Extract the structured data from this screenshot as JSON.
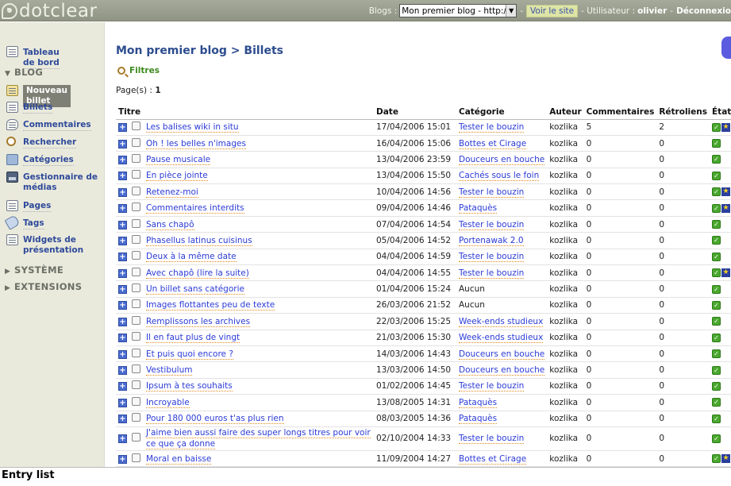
{
  "header": {
    "logo": "dotclear",
    "blogs_label": "Blogs :",
    "blog_select_value": "Mon premier blog - http:/",
    "view_site": "Voir le site",
    "user_label": "- Utilisateur :",
    "user_name": "olivier",
    "logout": "Déconnexio"
  },
  "sidebar": {
    "dashboard": "Tableau de bord",
    "blog_section": "BLOG",
    "new_entry": "Nouveau billet",
    "entries": "Billets",
    "comments": "Commentaires",
    "search": "Rechercher",
    "categories": "Catégories",
    "media_manager": "Gestionnaire de médias",
    "pages": "Pages",
    "tags": "Tags",
    "widgets": "Widgets de présentation",
    "system_section": "SYSTÈME",
    "extensions_section": "EXTENSIONS"
  },
  "main": {
    "page_title": "Mon premier blog > Billets",
    "filters": "Filtres",
    "pages_label": "Page(s) :",
    "pages_value": "1",
    "columns": [
      "Titre",
      "Date",
      "Catégorie",
      "Auteur",
      "Commentaires",
      "Rétroliens",
      "État"
    ],
    "rows": [
      {
        "title": "Les balises wiki in situ",
        "date": "17/04/2006 15:01",
        "category": "Tester le bouzin",
        "author": "kozlika",
        "comments": "5",
        "trackbacks": "2",
        "star": true
      },
      {
        "title": "Oh ! les belles n'images",
        "date": "16/04/2006 15:06",
        "category": "Bottes et Cirage",
        "author": "kozlika",
        "comments": "0",
        "trackbacks": "0",
        "star": false
      },
      {
        "title": "Pause musicale",
        "date": "13/04/2006 23:59",
        "category": "Douceurs en bouche",
        "author": "kozlika",
        "comments": "0",
        "trackbacks": "0",
        "star": false
      },
      {
        "title": "En pièce jointe",
        "date": "13/04/2006 15:50",
        "category": "Cachés sous le foin",
        "author": "kozlika",
        "comments": "0",
        "trackbacks": "0",
        "star": false
      },
      {
        "title": "Retenez-moi",
        "date": "10/04/2006 14:56",
        "category": "Tester le bouzin",
        "author": "kozlika",
        "comments": "0",
        "trackbacks": "0",
        "star": true
      },
      {
        "title": "Commentaires interdits",
        "date": "09/04/2006 14:46",
        "category": "Pataquès",
        "author": "kozlika",
        "comments": "0",
        "trackbacks": "0",
        "star": true
      },
      {
        "title": "Sans chapô",
        "date": "07/04/2006 14:54",
        "category": "Tester le bouzin",
        "author": "kozlika",
        "comments": "0",
        "trackbacks": "0",
        "star": false
      },
      {
        "title": "Phasellus latinus cuisinus",
        "date": "05/04/2006 14:52",
        "category": "Portenawak 2.0",
        "author": "kozlika",
        "comments": "0",
        "trackbacks": "0",
        "star": false
      },
      {
        "title": "Deux à la même date",
        "date": "04/04/2006 14:59",
        "category": "Tester le bouzin",
        "author": "kozlika",
        "comments": "0",
        "trackbacks": "0",
        "star": false
      },
      {
        "title": "Avec chapô (lire la suite)",
        "date": "04/04/2006 14:55",
        "category": "Tester le bouzin",
        "author": "kozlika",
        "comments": "0",
        "trackbacks": "0",
        "star": true
      },
      {
        "title": "Un billet sans catégorie",
        "date": "01/04/2006 15:24",
        "category": "Aucun",
        "author": "kozlika",
        "comments": "0",
        "trackbacks": "0",
        "star": false
      },
      {
        "title": "Images flottantes peu de texte",
        "date": "26/03/2006 21:52",
        "category": "Aucun",
        "author": "kozlika",
        "comments": "0",
        "trackbacks": "0",
        "star": false
      },
      {
        "title": "Remplissons les archives",
        "date": "22/03/2006 15:25",
        "category": "Week-ends studieux",
        "author": "kozlika",
        "comments": "0",
        "trackbacks": "0",
        "star": false
      },
      {
        "title": "Il en faut plus de vingt",
        "date": "21/03/2006 15:30",
        "category": "Week-ends studieux",
        "author": "kozlika",
        "comments": "0",
        "trackbacks": "0",
        "star": false
      },
      {
        "title": "Et puis quoi encore ?",
        "date": "14/03/2006 14:43",
        "category": "Douceurs en bouche",
        "author": "kozlika",
        "comments": "0",
        "trackbacks": "0",
        "star": false
      },
      {
        "title": "Vestibulum",
        "date": "13/03/2006 14:50",
        "category": "Douceurs en bouche",
        "author": "kozlika",
        "comments": "0",
        "trackbacks": "0",
        "star": false
      },
      {
        "title": "Ipsum à tes souhaits",
        "date": "01/02/2006 14:45",
        "category": "Tester le bouzin",
        "author": "kozlika",
        "comments": "0",
        "trackbacks": "0",
        "star": false
      },
      {
        "title": "Incroyable",
        "date": "13/08/2005 14:31",
        "category": "Pataquès",
        "author": "kozlika",
        "comments": "0",
        "trackbacks": "0",
        "star": false
      },
      {
        "title": "Pour 180 000 euros t'as plus rien",
        "date": "08/03/2005 14:36",
        "category": "Pataquès",
        "author": "kozlika",
        "comments": "0",
        "trackbacks": "0",
        "star": false
      },
      {
        "title": "J'aime bien aussi faire des super longs titres pour voir ce que ça donne",
        "date": "02/10/2004 14:33",
        "category": "Tester le bouzin",
        "author": "kozlika",
        "comments": "0",
        "trackbacks": "0",
        "star": false
      },
      {
        "title": "Moral en baisse",
        "date": "11/09/2004 14:27",
        "category": "Bottes et Cirage",
        "author": "kozlika",
        "comments": "0",
        "trackbacks": "0",
        "star": true
      }
    ]
  },
  "caption": "Entry list"
}
